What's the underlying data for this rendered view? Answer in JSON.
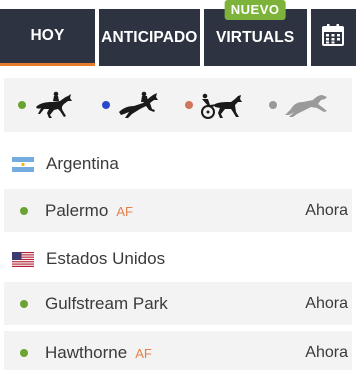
{
  "tabs": {
    "hoy": "HOY",
    "anticipado": "ANTICIPADO",
    "virtuals": "VIRTUALS",
    "virtuals_badge": "NUEVO",
    "calendar_icon": "calendar-icon"
  },
  "filters": [
    {
      "icon": "horse-racing-icon",
      "dot_color": "#6aa331"
    },
    {
      "icon": "horse-jumping-icon",
      "dot_color": "#2a48c9"
    },
    {
      "icon": "harness-racing-icon",
      "dot_color": "#d0745a"
    },
    {
      "icon": "greyhound-racing-icon",
      "dot_color": "#999999"
    }
  ],
  "sections": [
    {
      "country": "Argentina",
      "flag": "argentina-flag-icon",
      "races": [
        {
          "name": "Palermo",
          "tag": "AF",
          "time": "Ahora"
        }
      ]
    },
    {
      "country": "Estados Unidos",
      "flag": "usa-flag-icon",
      "races": [
        {
          "name": "Gulfstream Park",
          "tag": "",
          "time": "Ahora"
        },
        {
          "name": "Hawthorne",
          "tag": "AF",
          "time": "Ahora"
        }
      ]
    }
  ],
  "colors": {
    "tab_bg": "#2d3340",
    "active_underline": "#e87a2b",
    "badge_bg": "#7db33b",
    "row_bg": "#f3f3f3",
    "live_dot": "#6aa331",
    "af_tag": "#e6804a"
  }
}
